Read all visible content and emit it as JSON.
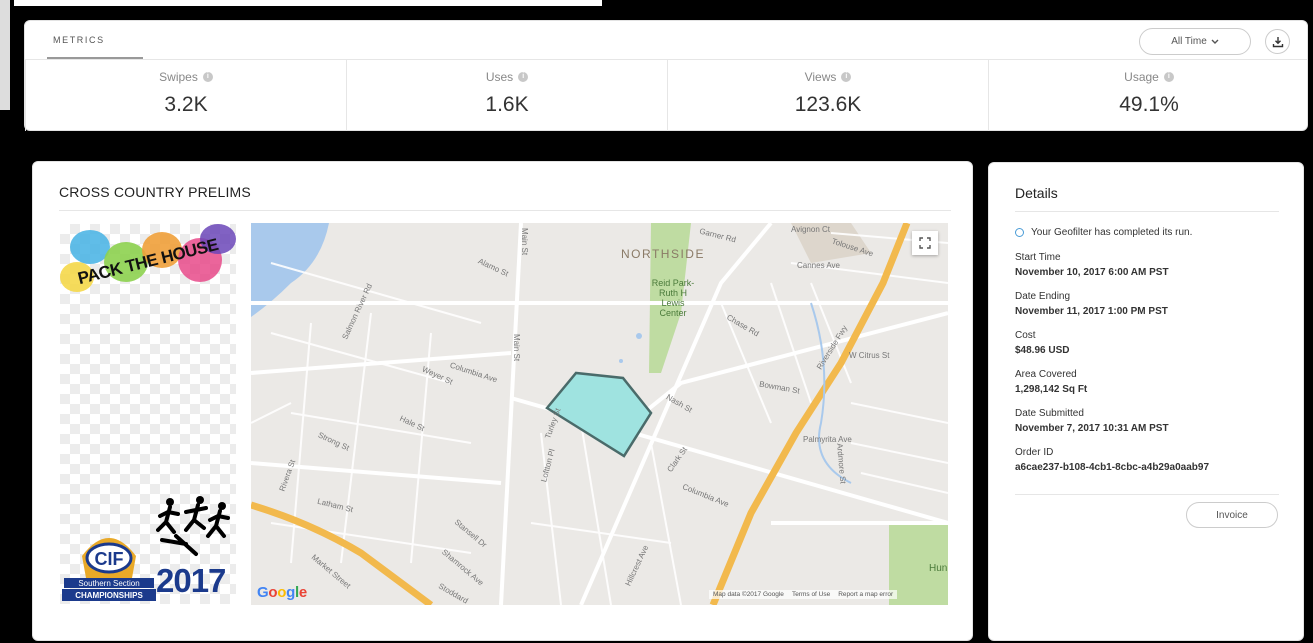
{
  "metrics": {
    "tab_label": "METRICS",
    "time_range": "All Time",
    "stats": [
      {
        "label": "Swipes",
        "value": "3.2K"
      },
      {
        "label": "Uses",
        "value": "1.6K"
      },
      {
        "label": "Views",
        "value": "123.6K"
      },
      {
        "label": "Usage",
        "value": "49.1%"
      }
    ]
  },
  "geofilter": {
    "title": "CROSS COUNTRY PRELIMS",
    "art_top_text": "PACK THE HOUSE",
    "art_bottom_text": "2017",
    "logo_text": [
      "CIF",
      "Southern Section",
      "CHAMPIONSHIPS"
    ]
  },
  "map": {
    "labels": {
      "northside": "NORTHSIDE",
      "park": "Reid Park-Ruth H Lewis Center",
      "columbia_ave": "Columbia Ave",
      "columbia_ave2": "Columbia Ave",
      "main_st": "Main St",
      "main_st2": "Main St",
      "nash_st": "Nash St",
      "clark_st": "Clark St",
      "w_citrus_st": "W Citrus St",
      "palmyrita_ave": "Palmyrita Ave",
      "riverside_fwy": "Riverside Fwy",
      "avignon_ct": "Avignon Ct",
      "tolouse_ave": "Tolouse Ave",
      "cannes_ave": "Cannes Ave",
      "garner_rd": "Garner Rd",
      "alamo_st": "Alamo St",
      "salmon_river_rd": "Salmon River Rd",
      "rivera_st": "Rivera St",
      "strong_st": "Strong St",
      "hale_st": "Hale St",
      "latham_st": "Latham St",
      "market_street": "Market Street",
      "stansell_dr": "Stansell Dr",
      "shamrock_ave": "Shamrock Ave",
      "stoddard": "Stoddard",
      "hillcrest_ave": "Hillcrest Ave",
      "loftton_pl": "Loftton Pl",
      "turley_st": "Turley St",
      "chase_rd": "Chase Rd",
      "bowman_st": "Bowman St",
      "ardmore_st": "Ardmore St",
      "weyer_st": "Weyer St",
      "hun": "Hun"
    },
    "google": [
      "G",
      "o",
      "o",
      "g",
      "l",
      "e"
    ],
    "footer": {
      "data": "Map data ©2017 Google",
      "terms": "Terms of Use",
      "report": "Report a map error"
    }
  },
  "details": {
    "title": "Details",
    "status": "Your Geofilter has completed its run.",
    "fields": [
      {
        "label": "Start Time",
        "value": "November 10, 2017 6:00 AM  PST"
      },
      {
        "label": "Date Ending",
        "value": "November 11, 2017 1:00 PM  PST"
      },
      {
        "label": "Cost",
        "value": "$48.96 USD"
      },
      {
        "label": "Area Covered",
        "value": "1,298,142 Sq Ft"
      },
      {
        "label": "Date Submitted",
        "value": "November 7, 2017 10:31 AM  PST"
      },
      {
        "label": "Order ID",
        "value": "a6cae237-b108-4cb1-8cbc-a4b29a0aab97"
      }
    ],
    "invoice_label": "Invoice"
  },
  "colors": {
    "geofence_fill": "#9fe3e0",
    "geofence_stroke": "#4a6b6a",
    "park": "#bfdca2",
    "water": "#a9c9ec",
    "freeway": "#f2b94d",
    "accent_blue": "#4a9cd6"
  }
}
